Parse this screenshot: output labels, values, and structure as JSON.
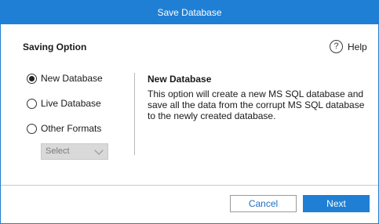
{
  "window": {
    "title": "Save Database"
  },
  "saving_option": {
    "heading": "Saving Option",
    "help_icon_glyph": "?",
    "help_label": "Help",
    "options": [
      {
        "label": "New Database",
        "checked": true
      },
      {
        "label": "Live Database",
        "checked": false
      },
      {
        "label": "Other Formats",
        "checked": false
      }
    ],
    "format_select": {
      "value": "Select",
      "disabled": true
    }
  },
  "description": {
    "title": "New Database",
    "text": "This option will create a new MS SQL database and save all the data from the corrupt MS SQL database to the newly created database."
  },
  "footer": {
    "cancel_label": "Cancel",
    "next_label": "Next"
  },
  "colors": {
    "accent": "#1e7fd4",
    "cancel_text": "#1e6fc0",
    "disabled_select": "#d9d9d9"
  }
}
